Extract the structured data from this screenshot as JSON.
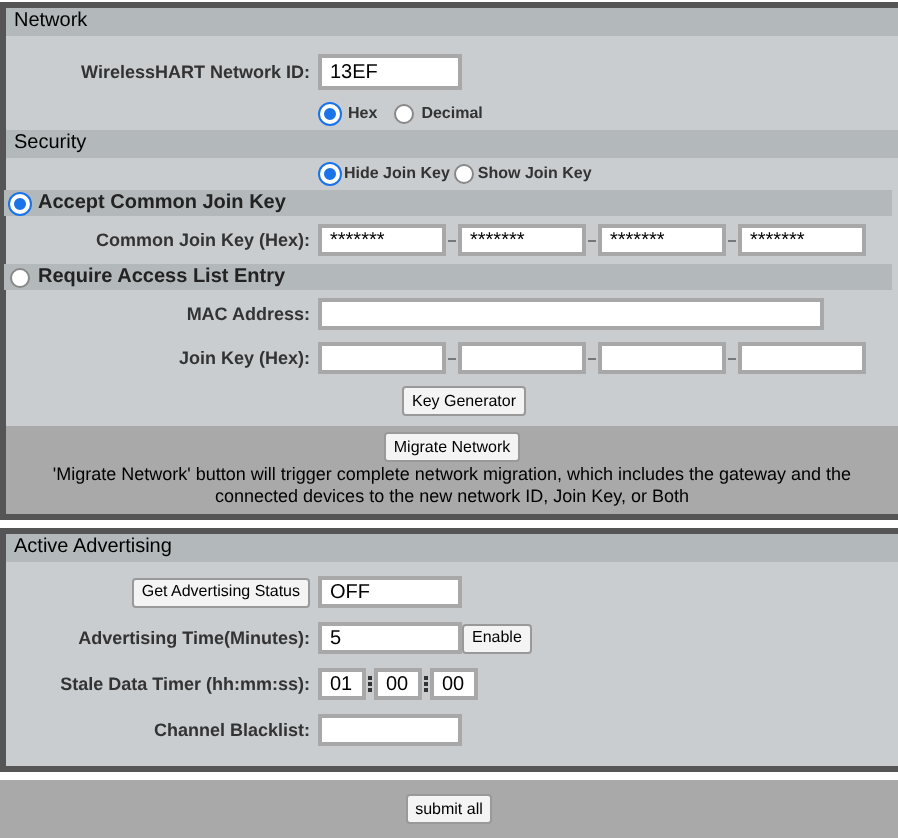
{
  "network": {
    "title": "Network",
    "id_label": "WirelessHART Network ID:",
    "id_value": "13EF",
    "format_options": [
      {
        "label": "Hex",
        "selected": true
      },
      {
        "label": "Decimal",
        "selected": false
      }
    ]
  },
  "security": {
    "title": "Security",
    "visibility_options": [
      {
        "label": "Hide Join Key",
        "selected": true
      },
      {
        "label": "Show Join Key",
        "selected": false
      }
    ],
    "modes": [
      {
        "title": "Accept Common Join Key",
        "selected": true,
        "fields": [
          {
            "kind": "key",
            "label": "Common Join Key (Hex):",
            "parts": [
              "*******",
              "*******",
              "*******",
              "*******"
            ]
          }
        ]
      },
      {
        "title": "Require Access List Entry",
        "selected": false,
        "fields": [
          {
            "kind": "text",
            "label": "MAC Address:"
          },
          {
            "kind": "key",
            "label": "Join Key (Hex):"
          }
        ],
        "button": "Key Generator"
      }
    ]
  },
  "migrate": {
    "button": "Migrate Network",
    "note": "'Migrate Network' button will trigger complete network migration, which includes the gateway and the connected devices to the new network ID, Join Key, or Both"
  },
  "advertising": {
    "title": "Active Advertising",
    "status_button": "Get Advertising Status",
    "status_value": "OFF",
    "time_label": "Advertising Time(Minutes):",
    "time_value": "5",
    "enable_button": "Enable",
    "stale_label": "Stale Data Timer (hh:mm:ss):",
    "stale_parts": [
      "01",
      "00",
      "00"
    ],
    "blacklist_label": "Channel Blacklist:"
  },
  "footer": {
    "button": "submit all"
  }
}
